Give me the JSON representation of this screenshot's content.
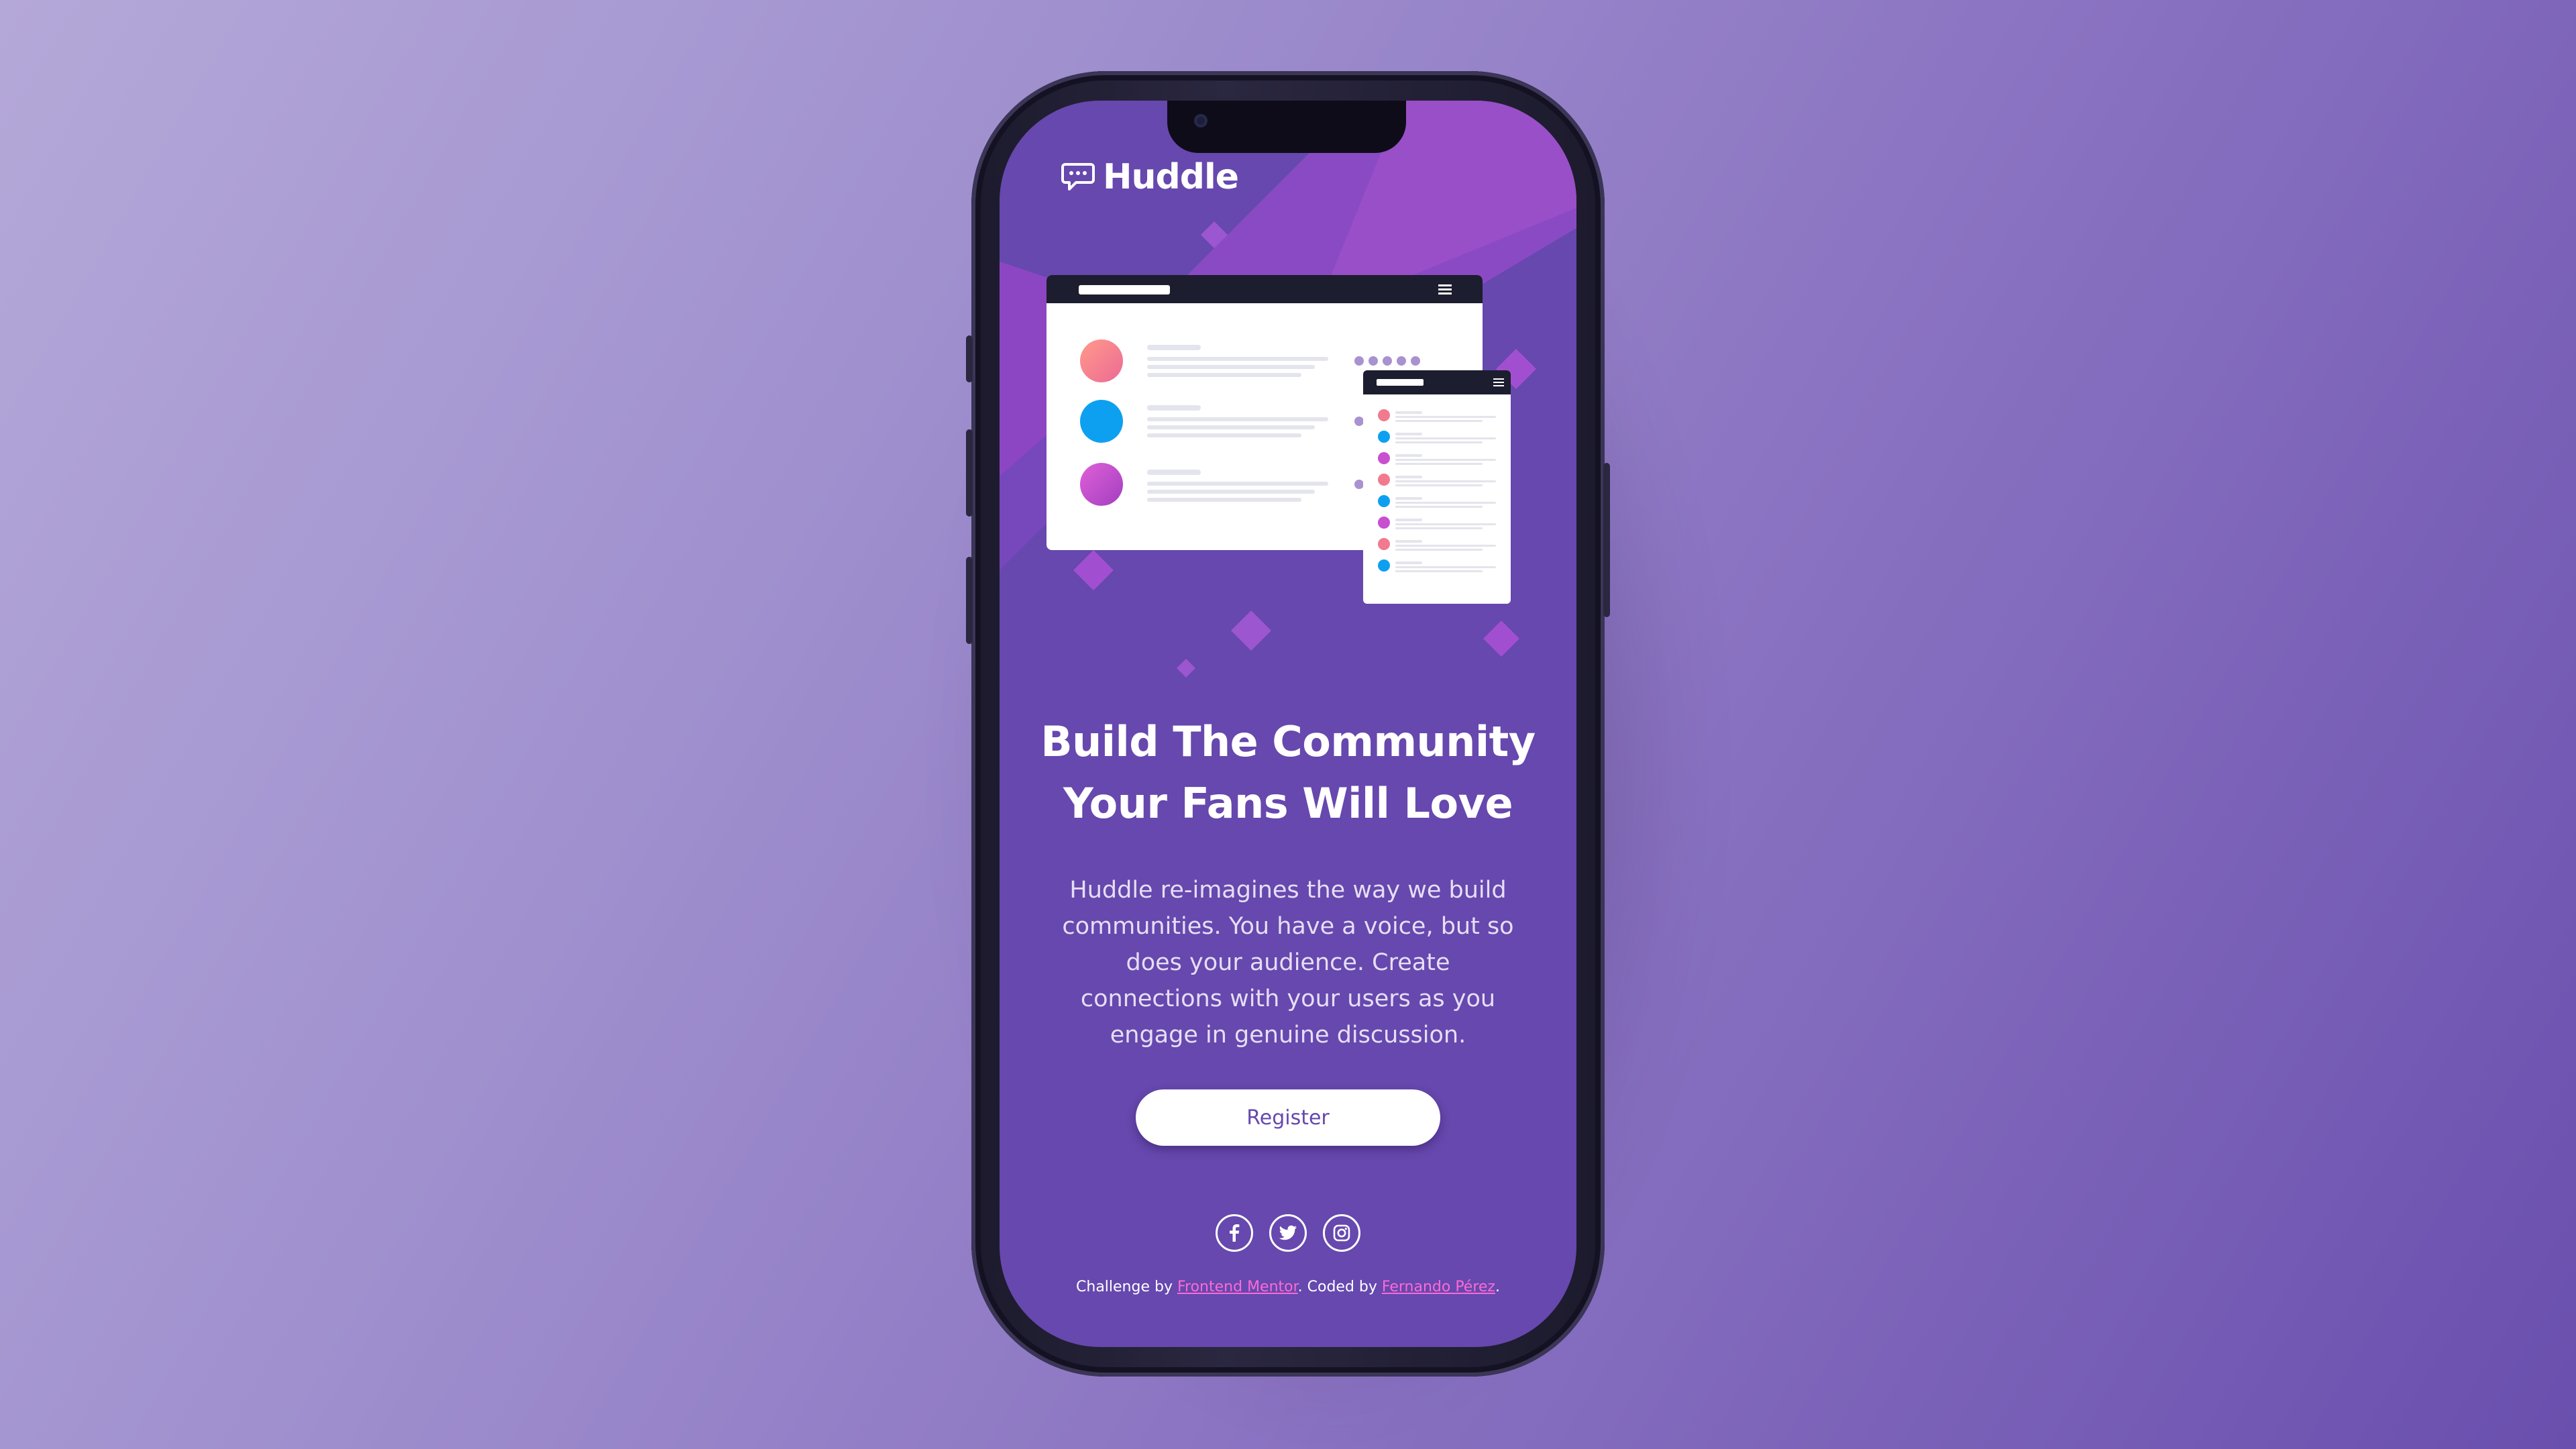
{
  "brand": {
    "name": "Huddle"
  },
  "hero": {
    "headline_line1": "Build The Community",
    "headline_line2": "Your Fans Will Love",
    "description": "Huddle re-imagines the way we build communities. You have a voice, but so does your audience. Create connections with your users as you engage in genuine discussion."
  },
  "cta": {
    "register_label": "Register"
  },
  "socials": [
    {
      "icon": "facebook-icon"
    },
    {
      "icon": "twitter-icon"
    },
    {
      "icon": "instagram-icon"
    }
  ],
  "footer": {
    "prefix": "Challenge by ",
    "link1": "Frontend Mentor",
    "middle": ". Coded by ",
    "link2": "Fernando Pérez",
    "suffix": "."
  },
  "colors": {
    "page_bg_start": "#b4a8d8",
    "page_bg_end": "#6a4fae",
    "screen_bg": "#6648ae",
    "accent_pink": "#ff6ad5",
    "button_text": "#6648ae"
  }
}
